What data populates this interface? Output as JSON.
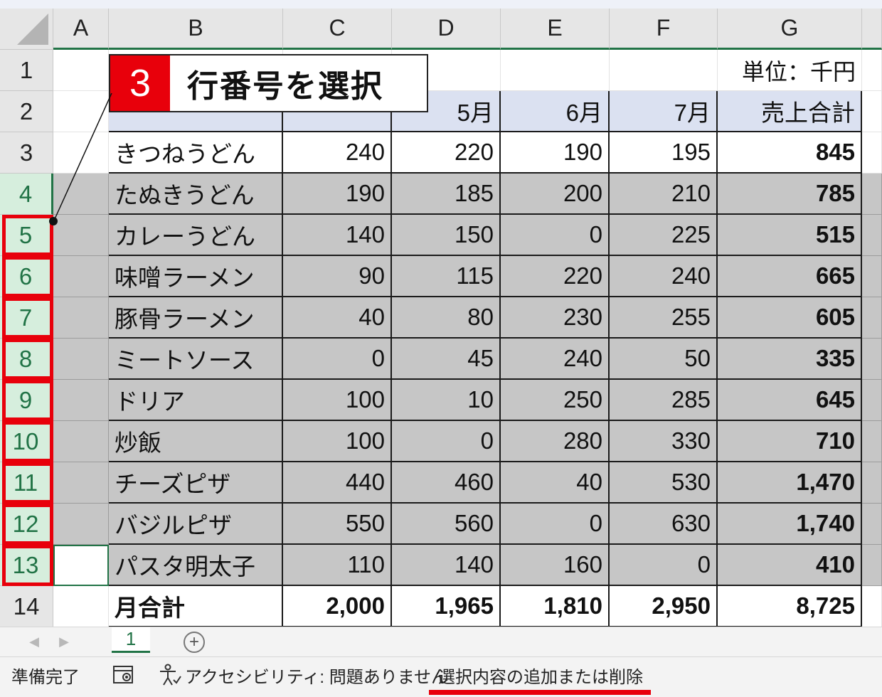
{
  "columns": [
    "A",
    "B",
    "C",
    "D",
    "E",
    "F",
    "G"
  ],
  "rows": [
    {
      "num": "1",
      "b": "",
      "c": "",
      "d": "",
      "e": "",
      "f": "",
      "g": "単位：千円",
      "selected": false
    },
    {
      "num": "2",
      "b": "",
      "c": "",
      "d": "5月",
      "e": "6月",
      "f": "7月",
      "g": "売上合計",
      "selected": false
    },
    {
      "num": "3",
      "b": "きつねうどん",
      "c": "240",
      "d": "220",
      "e": "190",
      "f": "195",
      "g": "845",
      "selected": false
    },
    {
      "num": "4",
      "b": "たぬきうどん",
      "c": "190",
      "d": "185",
      "e": "200",
      "f": "210",
      "g": "785",
      "selected": true
    },
    {
      "num": "5",
      "b": "カレーうどん",
      "c": "140",
      "d": "150",
      "e": "0",
      "f": "225",
      "g": "515",
      "selected": true
    },
    {
      "num": "6",
      "b": "味噌ラーメン",
      "c": "90",
      "d": "115",
      "e": "220",
      "f": "240",
      "g": "665",
      "selected": true
    },
    {
      "num": "7",
      "b": "豚骨ラーメン",
      "c": "40",
      "d": "80",
      "e": "230",
      "f": "255",
      "g": "605",
      "selected": true
    },
    {
      "num": "8",
      "b": "ミートソース",
      "c": "0",
      "d": "45",
      "e": "240",
      "f": "50",
      "g": "335",
      "selected": true
    },
    {
      "num": "9",
      "b": "ドリア",
      "c": "100",
      "d": "10",
      "e": "250",
      "f": "285",
      "g": "645",
      "selected": true
    },
    {
      "num": "10",
      "b": "炒飯",
      "c": "100",
      "d": "0",
      "e": "280",
      "f": "330",
      "g": "710",
      "selected": true
    },
    {
      "num": "11",
      "b": "チーズピザ",
      "c": "440",
      "d": "460",
      "e": "40",
      "f": "530",
      "g": "1,470",
      "selected": true
    },
    {
      "num": "12",
      "b": "バジルピザ",
      "c": "550",
      "d": "560",
      "e": "0",
      "f": "630",
      "g": "1,740",
      "selected": true
    },
    {
      "num": "13",
      "b": "パスタ明太子",
      "c": "110",
      "d": "140",
      "e": "160",
      "f": "0",
      "g": "410",
      "selected": true
    },
    {
      "num": "14",
      "b": "月合計",
      "c": "2,000",
      "d": "1,965",
      "e": "1,810",
      "f": "2,950",
      "g": "8,725",
      "selected": false
    }
  ],
  "callout": {
    "step": "3",
    "text": "行番号を選択"
  },
  "sheet": {
    "tab": "1",
    "add": "+"
  },
  "status": {
    "ready": "準備完了",
    "accessibility": "アクセシビリティ: 問題ありません",
    "selection_mode": "選択内容の追加または削除"
  },
  "colors": {
    "accent_green": "#217346",
    "highlight_red": "#e8000b",
    "selection_gray": "#c6c6c6",
    "header_blue": "#dbe1f1"
  }
}
